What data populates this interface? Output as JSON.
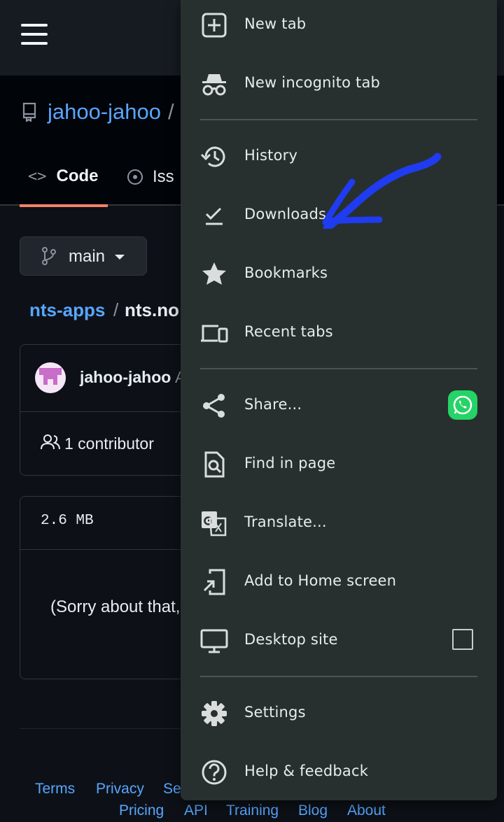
{
  "page": {
    "repo_owner": "jahoo-jahoo",
    "repo_separator": "/",
    "tabs": {
      "code": "Code",
      "issues": "Iss"
    },
    "branch": "main",
    "breadcrumb": {
      "folder": "nts-apps",
      "separator": "/",
      "file": "nts.no"
    },
    "commit": {
      "author": "jahoo-jahoo",
      "tail": "A"
    },
    "contributors": "1 contributor",
    "file_size": "2.6 MB",
    "error_message": "(Sorry about that,"
  },
  "footer": {
    "row1": [
      "Terms",
      "Privacy",
      "Se"
    ],
    "row2": [
      "Pricing",
      "API",
      "Training",
      "Blog",
      "About"
    ]
  },
  "menu": {
    "items": [
      {
        "label": "New tab",
        "icon": "add-box-icon"
      },
      {
        "label": "New incognito tab",
        "icon": "incognito-icon"
      },
      {
        "label": "History",
        "icon": "history-icon"
      },
      {
        "label": "Downloads",
        "icon": "download-done-icon"
      },
      {
        "label": "Bookmarks",
        "icon": "star-icon"
      },
      {
        "label": "Recent tabs",
        "icon": "devices-icon"
      },
      {
        "label": "Share...",
        "icon": "share-icon"
      },
      {
        "label": "Find in page",
        "icon": "find-in-page-icon"
      },
      {
        "label": "Translate...",
        "icon": "translate-icon"
      },
      {
        "label": "Add to Home screen",
        "icon": "add-to-home-icon"
      },
      {
        "label": "Desktop site",
        "icon": "desktop-icon"
      },
      {
        "label": "Settings",
        "icon": "gear-icon"
      },
      {
        "label": "Help & feedback",
        "icon": "help-icon"
      }
    ],
    "desktop_site_checked": false,
    "share_app": "whatsapp-icon"
  },
  "colors": {
    "menu_bg": "#27302e",
    "link": "#58a6ff",
    "annotation_arrow": "#1f3cf0",
    "whatsapp": "#25d366"
  }
}
